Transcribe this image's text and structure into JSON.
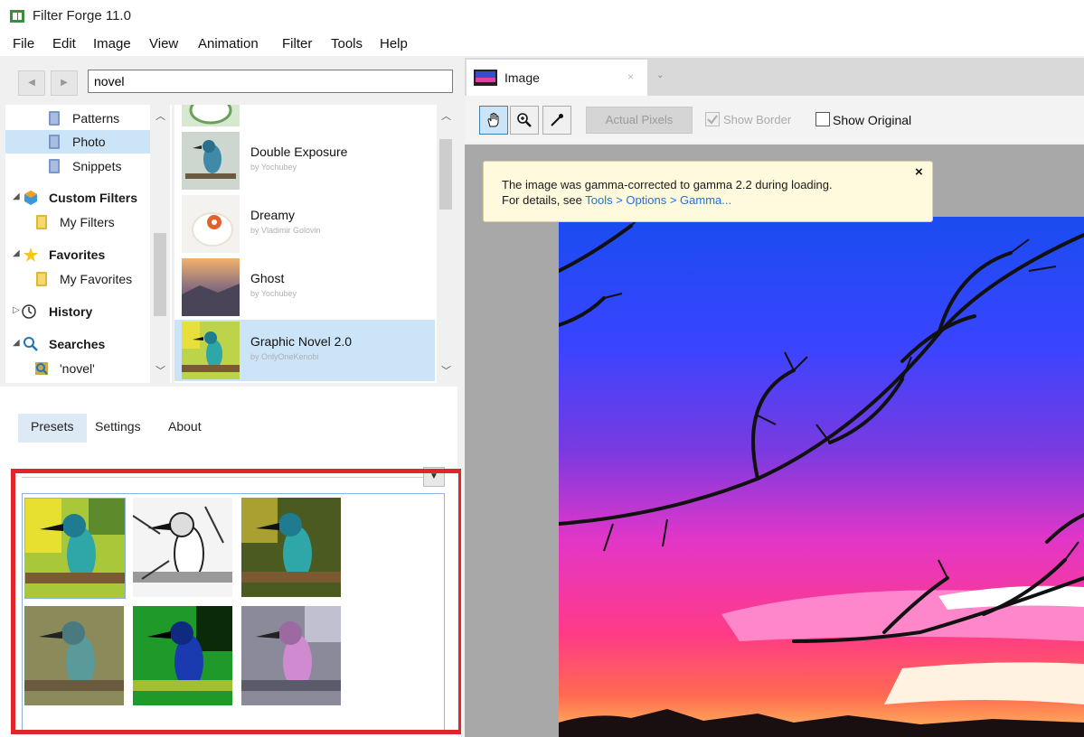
{
  "window": {
    "title": "Filter Forge 11.0"
  },
  "menu": [
    "File",
    "Edit",
    "Image",
    "View",
    "Animation",
    "Filter",
    "Tools",
    "Help"
  ],
  "search": {
    "value": "novel",
    "back_glyph": "◀",
    "forward_glyph": "▶"
  },
  "tree": {
    "items": [
      {
        "label": "Patterns",
        "icon": "folder-icon"
      },
      {
        "label": "Photo",
        "icon": "folder-icon",
        "selected": true
      },
      {
        "label": "Snippets",
        "icon": "folder-icon"
      },
      {
        "label": "Custom Filters",
        "icon": "cube-icon"
      },
      {
        "label": "My Filters",
        "icon": "folder-icon"
      },
      {
        "label": "Favorites",
        "icon": "star-icon"
      },
      {
        "label": "My Favorites",
        "icon": "folder-icon"
      },
      {
        "label": "History",
        "icon": "clock-icon"
      },
      {
        "label": "Searches",
        "icon": "magnifier-icon"
      },
      {
        "label": "'novel'",
        "icon": "magnifier-icon"
      }
    ]
  },
  "filters": [
    {
      "name": "Double Exposure",
      "author": "by Yochubey"
    },
    {
      "name": "Dreamy",
      "author": "by Vladimir Golovin"
    },
    {
      "name": "Ghost",
      "author": "by Yochubey"
    },
    {
      "name": "Graphic Novel 2.0",
      "author": "by OnlyOneKenobi",
      "selected": true
    }
  ],
  "tabs": [
    "Presets",
    "Settings",
    "About"
  ],
  "image_tab": {
    "label": "Image",
    "close": "×"
  },
  "toolbar": {
    "actual_pixels": "Actual Pixels",
    "show_border": "Show Border",
    "show_original": "Show Original",
    "show_border_checked": true,
    "show_original_checked": false
  },
  "notice": {
    "line1": "The image was gamma-corrected to gamma 2.2 during loading.",
    "line2_prefix": "For details, see ",
    "line2_link": "Tools > Options > Gamma...",
    "close": "×"
  },
  "colors": {
    "accent": "#0078d7",
    "highlight": "#e0262a",
    "selection": "#cce4f7",
    "link": "#1a73e8"
  }
}
